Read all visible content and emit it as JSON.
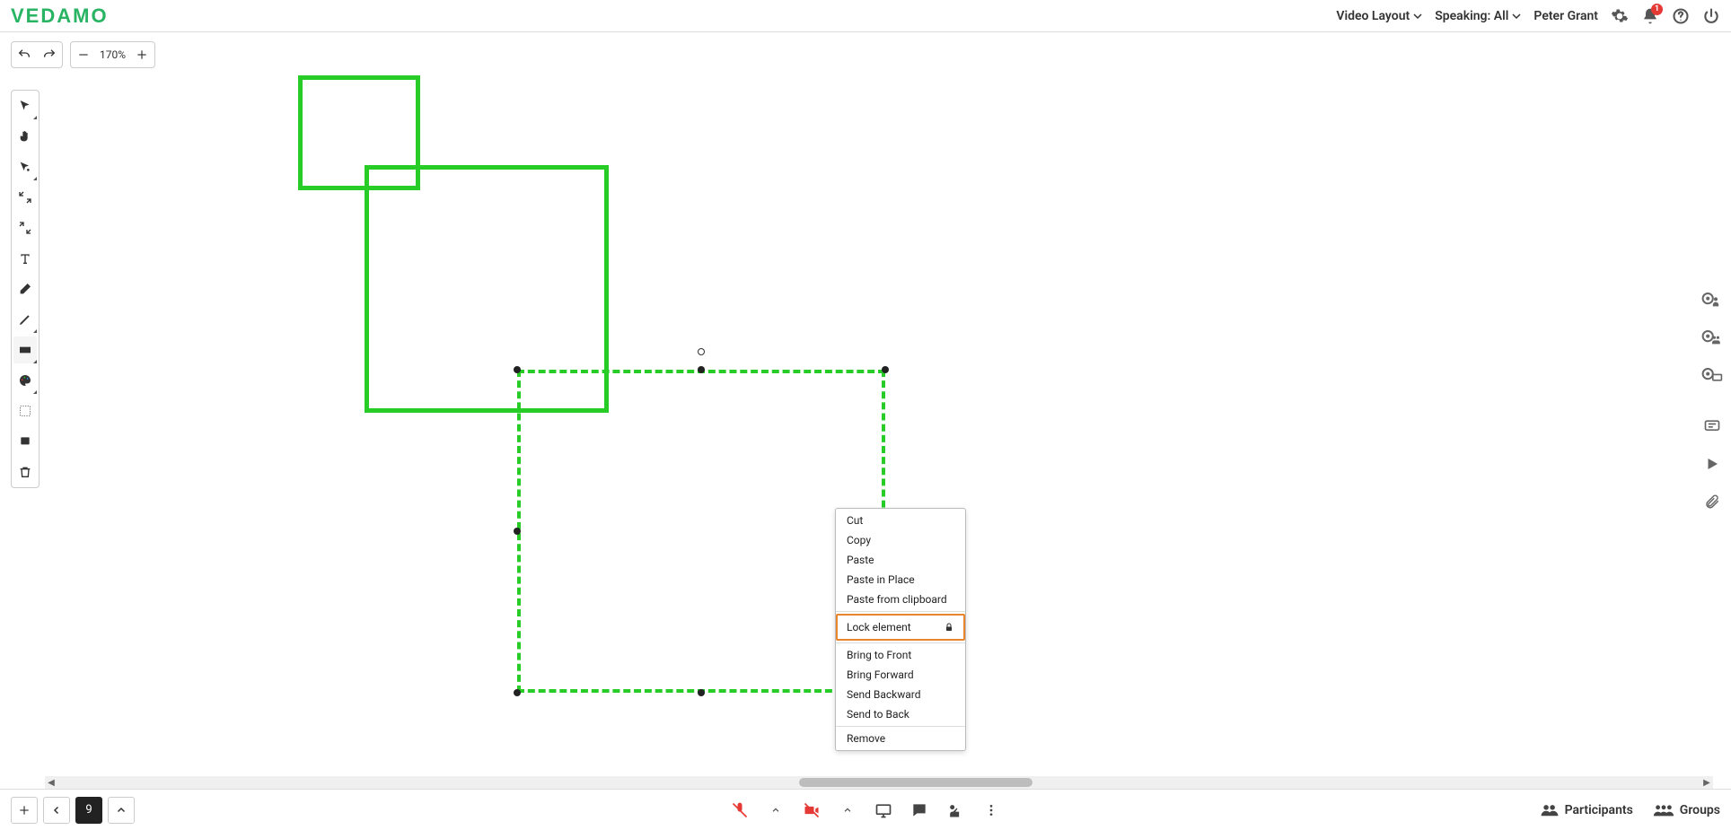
{
  "brand": "VEDAMO",
  "header": {
    "video_layout": "Video Layout",
    "speaking": "Speaking: All",
    "user": "Peter Grant",
    "notif_count": "1"
  },
  "zoom": "170%",
  "page_number": "9",
  "context_menu": {
    "cut": "Cut",
    "copy": "Copy",
    "paste": "Paste",
    "paste_in_place": "Paste in Place",
    "paste_from_clipboard": "Paste from clipboard",
    "lock_element": "Lock element",
    "bring_to_front": "Bring to Front",
    "bring_forward": "Bring Forward",
    "send_backward": "Send Backward",
    "send_to_back": "Send to Back",
    "remove": "Remove"
  },
  "bottom": {
    "participants": "Participants",
    "groups": "Groups"
  }
}
